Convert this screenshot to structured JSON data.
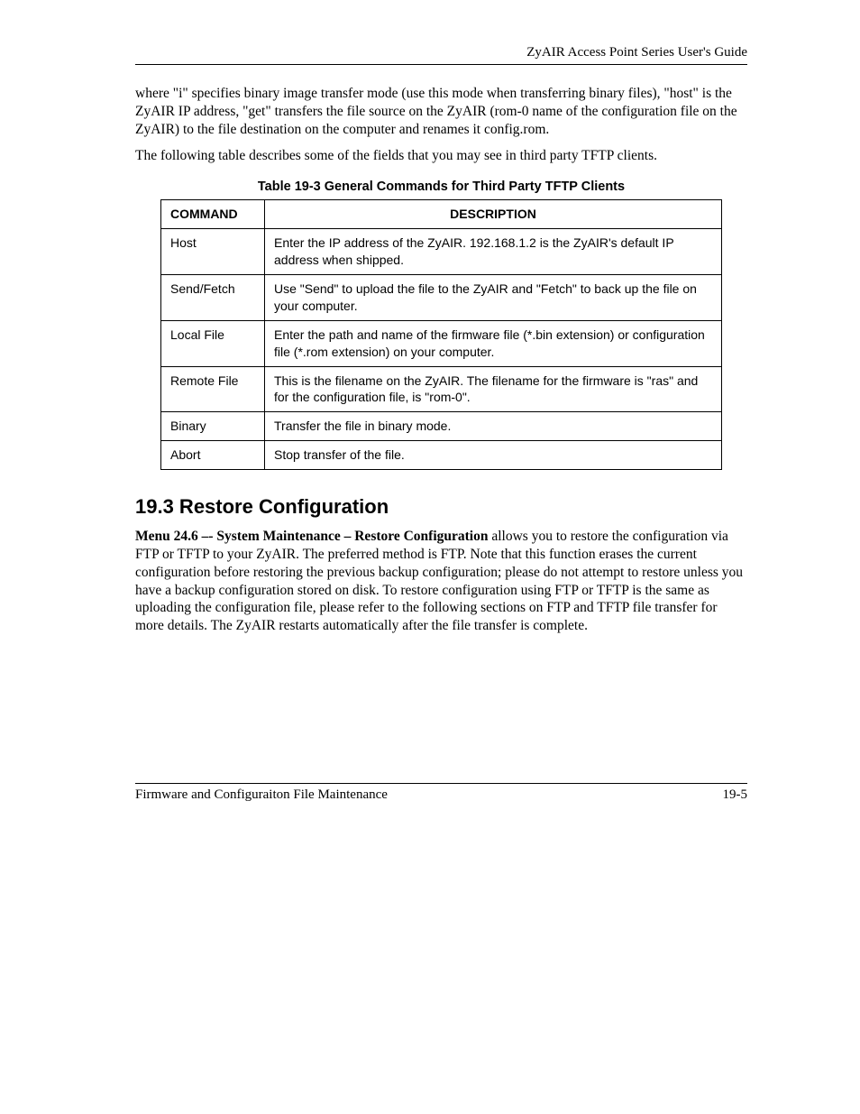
{
  "header": {
    "title": "ZyAIR Access Point Series User's Guide"
  },
  "intro": {
    "p1": "where \"i\" specifies binary image transfer mode (use this mode when transferring binary files), \"host\" is the ZyAIR IP address, \"get\" transfers the file source on the ZyAIR (rom-0 name of  the configuration file on the ZyAIR) to the file destination on the computer and renames it config.rom.",
    "p2": "The following table describes some of the fields that you may see in third party TFTP clients."
  },
  "table": {
    "title": "Table 19-3 General Commands for Third Party TFTP Clients",
    "col_command": "COMMAND",
    "col_description": "DESCRIPTION",
    "rows": [
      {
        "cmd": "Host",
        "desc": "Enter the IP address of the ZyAIR. 192.168.1.2 is the ZyAIR's default IP address when shipped."
      },
      {
        "cmd": "Send/Fetch",
        "desc": "Use \"Send\" to upload the file to the ZyAIR and \"Fetch\" to back up the file on your computer."
      },
      {
        "cmd": "Local File",
        "desc": "Enter the path and name of the firmware file (*.bin extension) or configuration file (*.rom extension) on your computer."
      },
      {
        "cmd": "Remote File",
        "desc": "This is the filename on the ZyAIR. The filename for the firmware is \"ras\" and for the configuration file, is \"rom-0\"."
      },
      {
        "cmd": "Binary",
        "desc": "Transfer the file in binary mode."
      },
      {
        "cmd": "Abort",
        "desc": "Stop transfer of the file."
      }
    ]
  },
  "section": {
    "heading": "19.3  Restore Configuration",
    "lead_bold": "Menu 24.6 –- System Maintenance – Restore Configuration",
    "body": " allows you to restore the configuration via FTP or TFTP to your ZyAIR. The preferred method is FTP. Note that this function erases the current configuration before restoring the previous backup configuration; please do not attempt to restore unless you have a backup configuration stored on disk. To restore configuration using FTP or TFTP is the same as uploading the configuration file, please refer to the following sections on FTP and TFTP file transfer for more details. The ZyAIR restarts automatically after the file transfer is complete."
  },
  "footer": {
    "left": "Firmware and Configuraiton File Maintenance",
    "right": "19-5"
  }
}
